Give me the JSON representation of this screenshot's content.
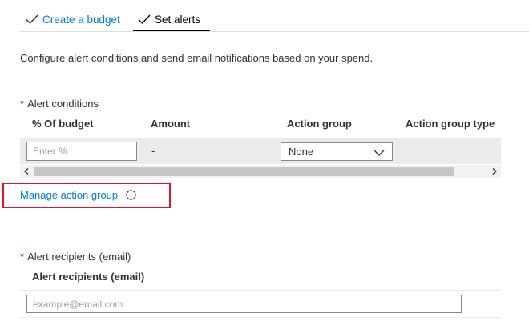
{
  "tabs": [
    {
      "label": "Create a budget",
      "icon": "checkmark-icon",
      "completed": true,
      "active": false
    },
    {
      "label": "Set alerts",
      "icon": "checkmark-icon",
      "completed": true,
      "active": true
    }
  ],
  "description": "Configure alert conditions and send email notifications based on your spend.",
  "alert_conditions": {
    "required_marker": "*",
    "label": "Alert conditions",
    "columns": [
      "% Of budget",
      "Amount",
      "Action group",
      "Action group type"
    ],
    "rows": [
      {
        "percent_value": "",
        "percent_placeholder": "Enter %",
        "amount": "-",
        "action_group": "None",
        "action_group_type": ""
      }
    ]
  },
  "manage_action_group": {
    "label": "Manage action group",
    "icon": "info-icon"
  },
  "alert_recipients": {
    "required_marker": "*",
    "label": "Alert recipients (email)",
    "column_header": "Alert recipients (email)",
    "email_value": "",
    "email_placeholder": "example@email.com"
  },
  "colors": {
    "link": "#0078d4",
    "required": "#a4262c",
    "highlight": "#e81123",
    "row_background": "#edebe9"
  }
}
